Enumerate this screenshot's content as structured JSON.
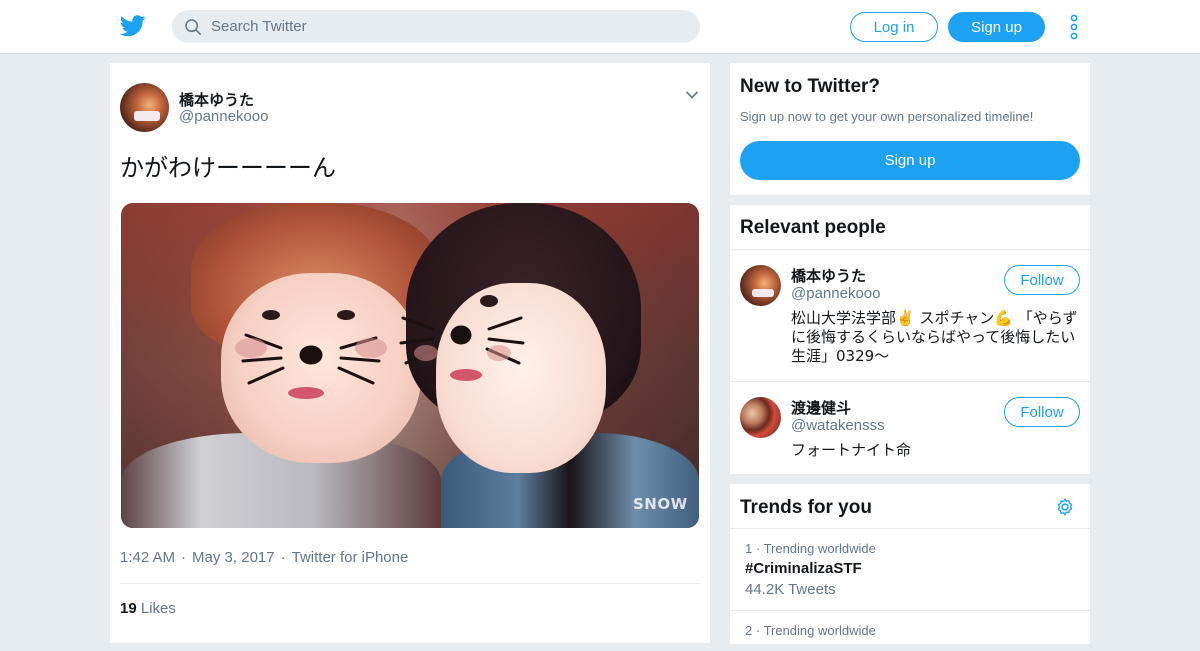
{
  "header": {
    "search_placeholder": "Search Twitter",
    "login_label": "Log in",
    "signup_label": "Sign up"
  },
  "tweet": {
    "author_name": "橋本ゆうた",
    "author_handle": "@pannekooo",
    "text": "かがわけーーーーん",
    "photo_watermark": "SNOW",
    "time": "1:42 AM",
    "date": "May 3, 2017",
    "source": "Twitter for iPhone",
    "likes_count": "19",
    "likes_label": "Likes"
  },
  "new_to_twitter": {
    "title": "New to Twitter?",
    "subtitle": "Sign up now to get your own personalized timeline!",
    "signup_label": "Sign up"
  },
  "relevant_people": {
    "title": "Relevant people",
    "people": [
      {
        "name": "橋本ゆうた",
        "handle": "@pannekooo",
        "bio": "松山大学法学部✌️ スポチャン💪 「やらずに後悔するくらいならばやって後悔したい生涯」0329〜",
        "follow_label": "Follow"
      },
      {
        "name": "渡邊健斗",
        "handle": "@watakensss",
        "bio": "フォートナイト命",
        "follow_label": "Follow"
      }
    ]
  },
  "trends": {
    "title": "Trends for you",
    "items": [
      {
        "rank": "1",
        "context": "Trending worldwide",
        "name": "#CriminalizaSTF",
        "count": "44.2K Tweets"
      },
      {
        "rank": "2",
        "context": "Trending worldwide"
      }
    ]
  },
  "colors": {
    "brand_blue": "#1da1f2",
    "background": "#e6ecf0",
    "secondary_text": "#657786"
  }
}
